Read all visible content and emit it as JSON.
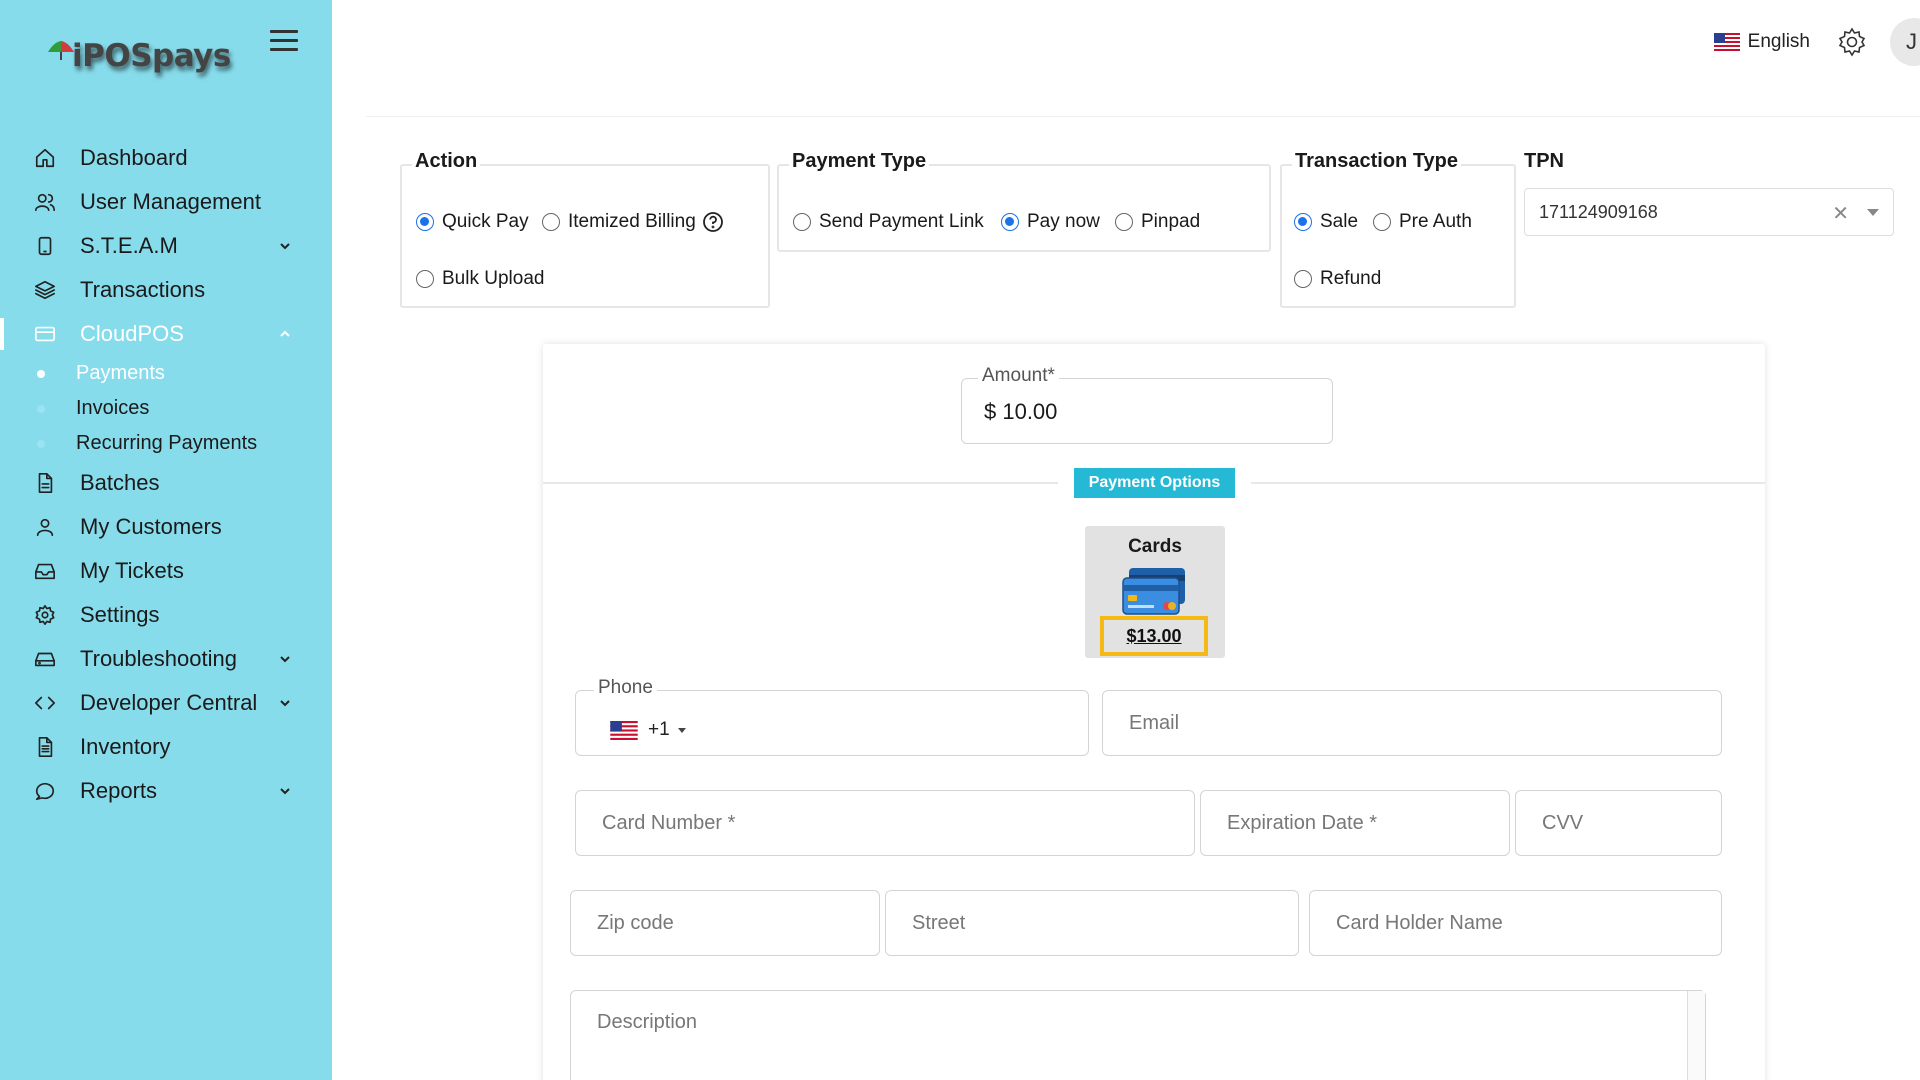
{
  "app": {
    "logo_text": "iPOSpays"
  },
  "header": {
    "language": "English",
    "avatar_initial": "J"
  },
  "sidebar": {
    "items": [
      {
        "label": "Dashboard",
        "icon": "home-icon"
      },
      {
        "label": "User Management",
        "icon": "users-icon"
      },
      {
        "label": "S.T.E.A.M",
        "icon": "tablet-icon",
        "expandable": true
      },
      {
        "label": "Transactions",
        "icon": "layers-icon"
      },
      {
        "label": "CloudPOS",
        "icon": "credit-card-icon",
        "expandable": true,
        "expanded": true,
        "active": true
      },
      {
        "label": "Batches",
        "icon": "file-icon"
      },
      {
        "label": "My Customers",
        "icon": "user-icon"
      },
      {
        "label": "My Tickets",
        "icon": "inbox-icon"
      },
      {
        "label": "Settings",
        "icon": "gear-icon"
      },
      {
        "label": "Troubleshooting",
        "icon": "hard-drive-icon",
        "expandable": true
      },
      {
        "label": "Developer Central",
        "icon": "code-icon",
        "expandable": true
      },
      {
        "label": "Inventory",
        "icon": "document-icon"
      },
      {
        "label": "Reports",
        "icon": "chat-icon",
        "expandable": true
      }
    ],
    "cloudpos_sub": [
      {
        "label": "Payments",
        "active": true
      },
      {
        "label": "Invoices"
      },
      {
        "label": "Recurring Payments"
      }
    ]
  },
  "action": {
    "title": "Action",
    "options": [
      "Quick Pay",
      "Itemized Billing",
      "Bulk Upload"
    ],
    "selected": "Quick Pay"
  },
  "payment_type": {
    "title": "Payment Type",
    "options": [
      "Send Payment Link",
      "Pay now",
      "Pinpad"
    ],
    "selected": "Pay now"
  },
  "transaction_type": {
    "title": "Transaction Type",
    "options": [
      "Sale",
      "Pre Auth",
      "Refund"
    ],
    "selected": "Sale"
  },
  "tpn": {
    "title": "TPN",
    "value": "171124909168"
  },
  "form": {
    "amount_label": "Amount*",
    "amount_value": "$ 10.00",
    "payment_options_label": "Payment Options",
    "card_option": {
      "title": "Cards",
      "price": "$13.00"
    },
    "phone_label": "Phone",
    "phone_code": "+1",
    "email_placeholder": "Email",
    "card_number_placeholder": "Card Number *",
    "expiration_placeholder": "Expiration Date *",
    "cvv_placeholder": "CVV",
    "zip_placeholder": "Zip code",
    "street_placeholder": "Street",
    "holder_placeholder": "Card Holder Name",
    "description_placeholder": "Description"
  },
  "colors": {
    "sidebar_bg": "#87dcec",
    "accent": "#26b9d5",
    "radio_checked": "#1a73e8",
    "highlight": "#f5b915"
  }
}
